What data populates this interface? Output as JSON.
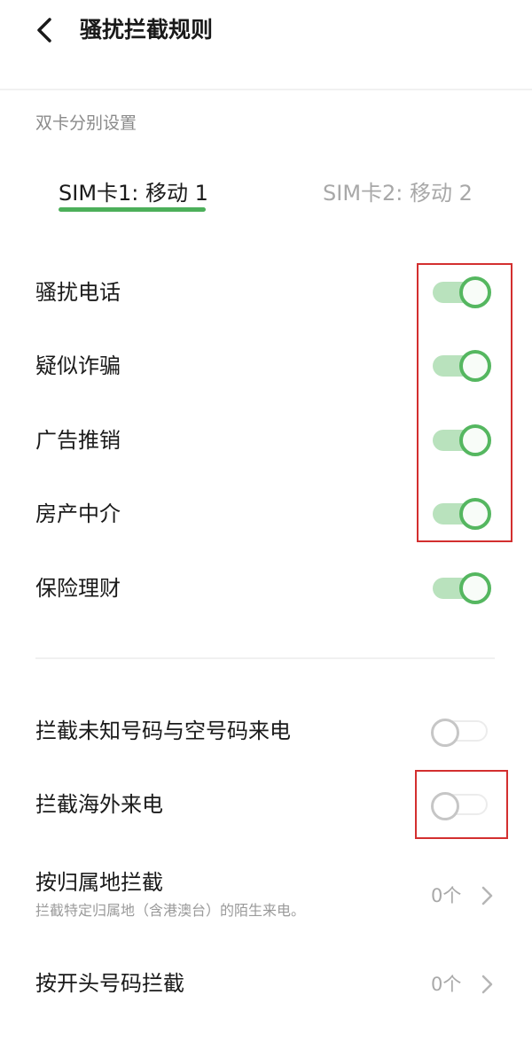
{
  "header": {
    "title": "骚扰拦截规则",
    "back_icon": "chevron-left-icon"
  },
  "section": {
    "label": "双卡分别设置"
  },
  "sim_tabs": [
    {
      "label": "SIM卡1: 移动 1",
      "active": true
    },
    {
      "label": "SIM卡2: 移动 2",
      "active": false
    }
  ],
  "categories": [
    {
      "label": "骚扰电话",
      "enabled": true
    },
    {
      "label": "疑似诈骗",
      "enabled": true
    },
    {
      "label": "广告推销",
      "enabled": true
    },
    {
      "label": "房产中介",
      "enabled": true
    },
    {
      "label": "保险理财",
      "enabled": true
    }
  ],
  "options": [
    {
      "label": "拦截未知号码与空号码来电",
      "enabled": false
    },
    {
      "label": "拦截海外来电",
      "enabled": false
    }
  ],
  "nav_rows": [
    {
      "title": "按归属地拦截",
      "subtitle": "拦截特定归属地（含港澳台）的陌生来电。",
      "value": "0个"
    },
    {
      "title": "按开头号码拦截",
      "value": "0个"
    }
  ],
  "colors": {
    "accent": "#55b760",
    "accent_track": "#b9e2bd",
    "highlight": "#d32f2f"
  }
}
